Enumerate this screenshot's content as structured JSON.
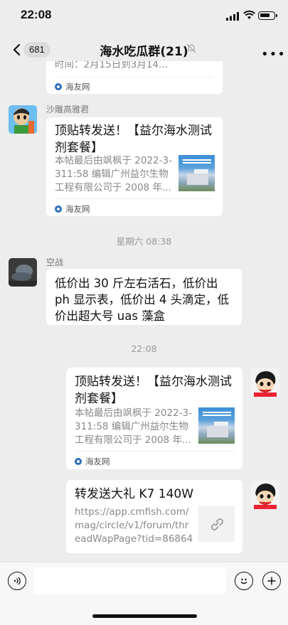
{
  "status": {
    "time": "22:08"
  },
  "header": {
    "back_count": "681",
    "title": "海水吃瓜群(21)"
  },
  "messages": {
    "m0": {
      "desc_partial": "时间：2月15日到3月14...",
      "source": "海友网"
    },
    "m1": {
      "sender": "沙雕高雅君",
      "title": "顶贴转发送！【益尔海水测试剂套餐】",
      "desc": "本帖最后由飒枫于 2022-3-311:58 编辑广州益尔生物工程有限公司于 2008 年...",
      "source": "海友网"
    },
    "ts1": "星期六 08:38",
    "m2": {
      "sender": "空战",
      "text": "低价出 30 斤左右活石，低价出 ph 显示表，低价出 4 头滴定，低价出超大号 uas 藻盒"
    },
    "ts2": "22:08",
    "m3": {
      "title": "顶贴转发送！【益尔海水测试剂套餐】",
      "desc": "本帖最后由飒枫于 2022-3-311:58 编辑广州益尔生物工程有限公司于 2008 年...",
      "source": "海友网"
    },
    "m4": {
      "title": "转发送大礼 K7 140W",
      "url": "https://app.cmfish.com/mag/circle/v1/forum/threadWapPage?tid=868644..."
    }
  },
  "icons": {
    "back": "chevron-left-icon",
    "mute": "bell-muted-icon",
    "more": "more-dots-icon",
    "voice": "voice-icon",
    "emoji": "emoji-icon",
    "plus": "plus-icon",
    "link": "link-icon"
  },
  "colors": {
    "background": "#ededed",
    "bubble": "#ffffff",
    "source_logo": "#2a6ebd"
  }
}
